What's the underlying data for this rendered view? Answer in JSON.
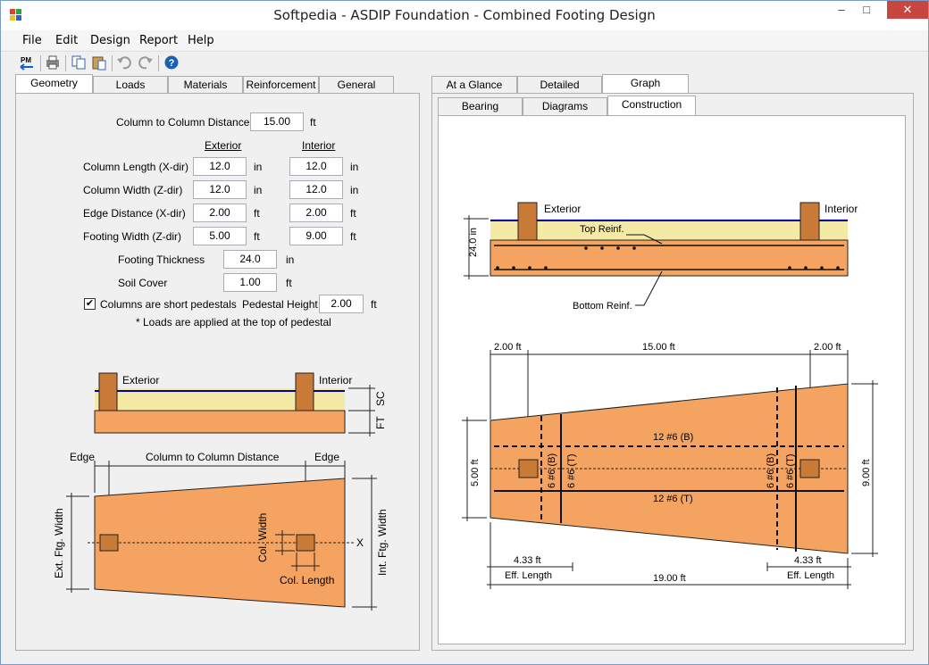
{
  "window": {
    "title": "Softpedia - ASDIP Foundation - Combined Footing Design",
    "minimize": "–",
    "maximize": "□",
    "close": "✕"
  },
  "menu": [
    "File",
    "Edit",
    "Design",
    "Report",
    "Help"
  ],
  "toolbar": {
    "pm_label": "PM"
  },
  "left_tabs": [
    "Geometry",
    "Loads",
    "Materials",
    "Reinforcement",
    "General"
  ],
  "right_tabs": [
    "At a Glance",
    "Detailed",
    "Graph"
  ],
  "graph_subtabs": [
    "Bearing",
    "Diagrams",
    "Construction"
  ],
  "geometry": {
    "col_distance_label": "Column to Column Distance",
    "col_distance_value": "15.00",
    "col_distance_unit": "ft",
    "exterior_header": "Exterior",
    "interior_header": "Interior",
    "rows": [
      {
        "label": "Column Length (X-dir)",
        "ext": "12.0",
        "ext_unit": "in",
        "int": "12.0",
        "int_unit": "in"
      },
      {
        "label": "Column Width (Z-dir)",
        "ext": "12.0",
        "ext_unit": "in",
        "int": "12.0",
        "int_unit": "in"
      },
      {
        "label": "Edge Distance (X-dir)",
        "ext": "2.00",
        "ext_unit": "ft",
        "int": "2.00",
        "int_unit": "ft"
      },
      {
        "label": "Footing Width (Z-dir)",
        "ext": "5.00",
        "ext_unit": "ft",
        "int": "9.00",
        "int_unit": "ft"
      }
    ],
    "thickness_label": "Footing Thickness",
    "thickness_value": "24.0",
    "thickness_unit": "in",
    "soil_label": "Soil Cover",
    "soil_value": "1.00",
    "soil_unit": "ft",
    "pedestal_check_label": "Columns are short pedestals",
    "pedestal_checked": "✔",
    "pedestal_height_label": "Pedestal Height",
    "pedestal_height_value": "2.00",
    "pedestal_height_unit": "ft",
    "note": "* Loads are applied at the top of pedestal"
  },
  "left_diagram": {
    "exterior": "Exterior",
    "interior": "Interior",
    "sc": "SC",
    "ft": "FT",
    "edge_left": "Edge",
    "edge_right": "Edge",
    "col_distance": "Column to Column Distance",
    "ext_width": "Ext. Ftg. Width",
    "int_width": "Int. Ftg. Width",
    "col_width": "Col. Width",
    "col_length": "Col. Length",
    "x_axis": "X"
  },
  "right_diagram": {
    "exterior": "Exterior",
    "interior": "Interior",
    "depth": "24.0 in",
    "top_reinf": "Top Reinf.",
    "bottom_reinf": "Bottom Reinf.",
    "dim_edge_left": "2.00 ft",
    "dim_span": "15.00 ft",
    "dim_edge_right": "2.00 ft",
    "width_left": "5.00 ft",
    "width_right": "9.00 ft",
    "bars_bottom_label": "12 #6 (B)",
    "bars_top_label": "12 #6 (T)",
    "trans_ext_b": "6 #6 (B)",
    "trans_ext_t": "6 #6 (T)",
    "trans_int_b": "6 #6 (B)",
    "trans_int_t": "6 #6 (T)",
    "eff_left_value": "4.33 ft",
    "eff_left_label": "Eff. Length",
    "eff_right_value": "4.33 ft",
    "eff_right_label": "Eff. Length",
    "total_length": "19.00 ft"
  },
  "colors": {
    "footing": "#f4a460",
    "soil": "#f5e9a6",
    "column": "#c97a36",
    "grade": "#0000a0"
  }
}
